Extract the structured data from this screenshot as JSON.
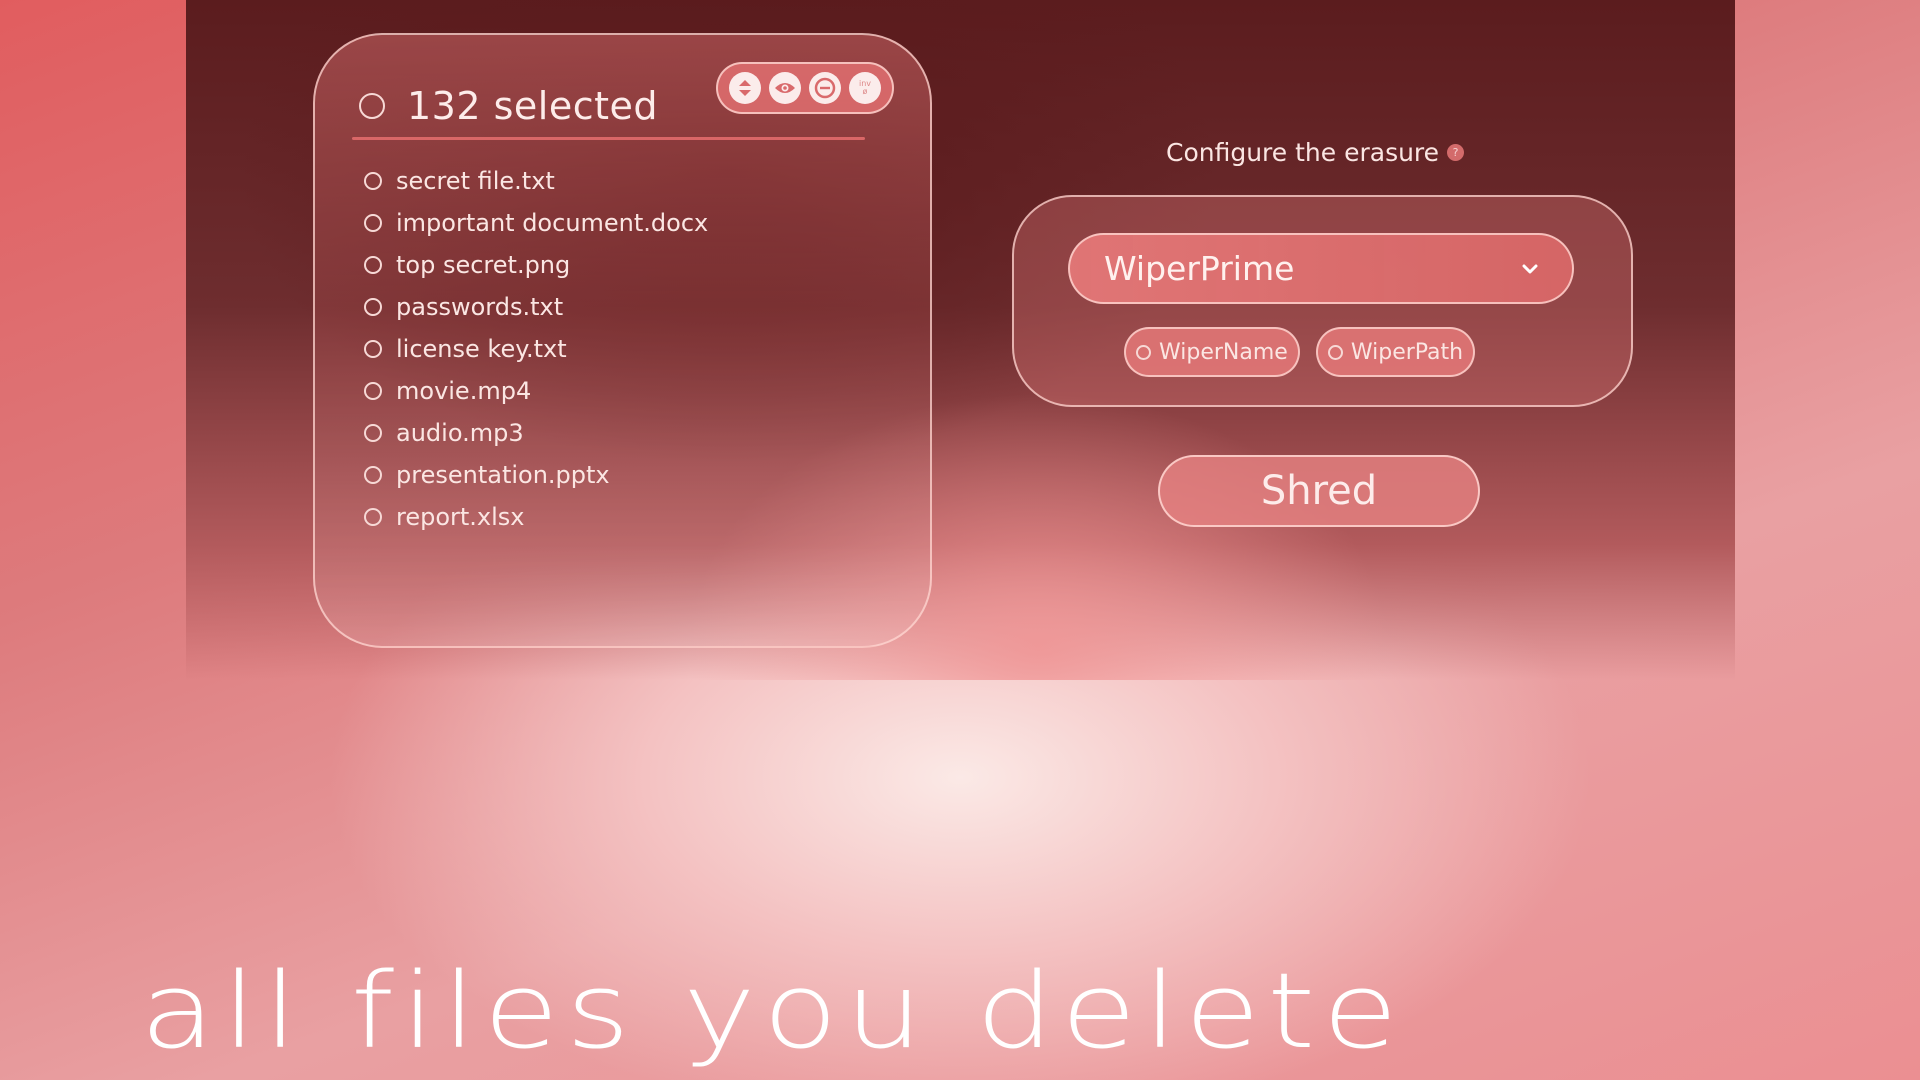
{
  "file_panel": {
    "selection_label": "132 selected",
    "toolbar": [
      {
        "name": "sort-icon",
        "label": "Sort"
      },
      {
        "name": "eye-icon",
        "label": "Preview"
      },
      {
        "name": "minus-circle-icon",
        "label": "Remove"
      },
      {
        "name": "invert-selection-icon",
        "label": "inv",
        "sub_glyph": "ø"
      }
    ],
    "files": [
      "secret file.txt",
      "important document.docx",
      "top secret.png",
      "passwords.txt",
      "license key.txt",
      "movie.mp4",
      "audio.mp3",
      "presentation.pptx",
      "report.xlsx"
    ]
  },
  "config": {
    "title": "Configure the erasure",
    "help_glyph": "?",
    "method_selected": "WiperPrime",
    "options": [
      {
        "label": "WiperName",
        "checked": false
      },
      {
        "label": "WiperPath",
        "checked": false
      }
    ]
  },
  "actions": {
    "shred_label": "Shred"
  },
  "tagline": "all files you delete",
  "colors": {
    "accent": "#e06a6c",
    "dark_bg": "#5b1c1e",
    "text_light": "#fbe6e3",
    "border": "#ffd7d2"
  }
}
